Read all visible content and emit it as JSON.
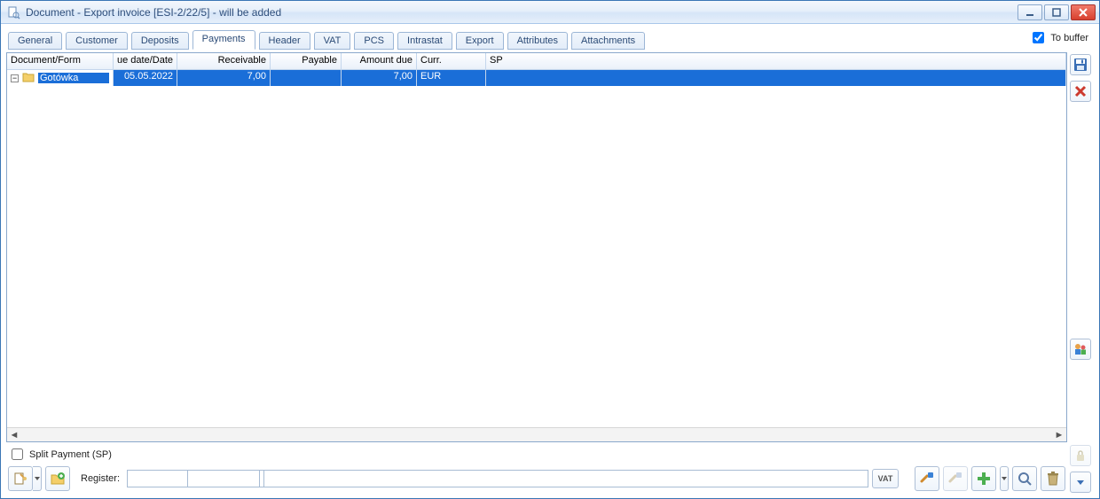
{
  "title": "Document - Export invoice [ESI-2/22/5]  - will be added",
  "tobuffer": {
    "label": "To buffer",
    "checked": true
  },
  "tabs": {
    "general": "General",
    "customer": "Customer",
    "deposits": "Deposits",
    "payments": "Payments",
    "header": "Header",
    "vat": "VAT",
    "pcs": "PCS",
    "intrastat": "Intrastat",
    "export": "Export",
    "attributes": "Attributes",
    "attachments": "Attachments"
  },
  "columns": {
    "docform": "Document/Form",
    "date": "ue date/Date",
    "receivable": "Receivable",
    "payable": "Payable",
    "amount_due": "Amount due",
    "currency": "Curr.",
    "sp": "SP"
  },
  "rows": [
    {
      "docform": "Gotówka",
      "date": "05.05.2022",
      "receivable": "7,00",
      "payable": "",
      "amount_due": "7,00",
      "currency": "EUR",
      "sp": ""
    }
  ],
  "split_payment": {
    "label": "Split Payment (SP)",
    "checked": false
  },
  "register": {
    "label": "Register:",
    "combo_value": "",
    "code_value": "",
    "name_value": ""
  },
  "vat_btn": "VAT"
}
